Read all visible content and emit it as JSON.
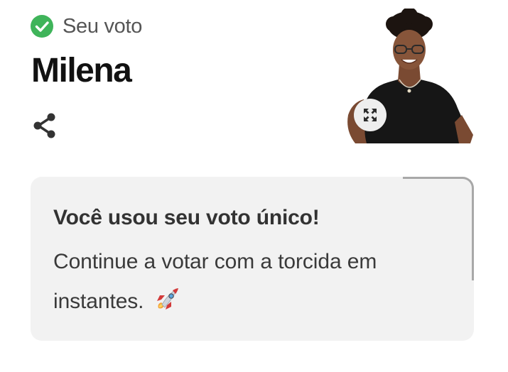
{
  "status": {
    "icon": "check-circle-icon",
    "label": "Seu voto",
    "icon_color": "#3fb45a"
  },
  "candidate": {
    "name": "Milena",
    "photo_icon": "person-portrait",
    "expand_icon": "expand-arrows-icon"
  },
  "share": {
    "icon": "share-icon"
  },
  "notice": {
    "title": "Você usou seu voto único!",
    "body": "Continue a votar com a torcida em instantes.",
    "emoji_icon": "rocket-icon",
    "background": "#f2f2f2"
  }
}
